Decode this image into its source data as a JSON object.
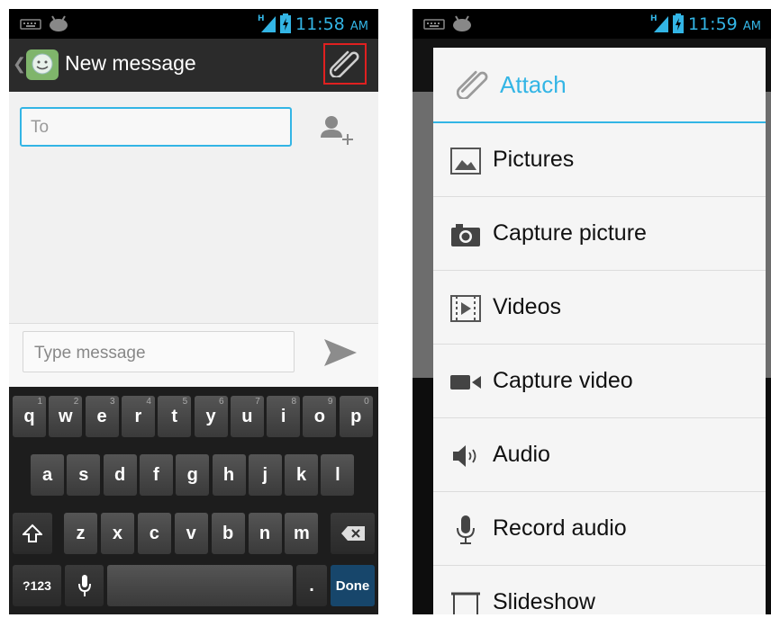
{
  "left": {
    "status": {
      "time": "11:58",
      "ampm": "AM"
    },
    "actionbar": {
      "title": "New message"
    },
    "compose": {
      "to_placeholder": "To",
      "message_placeholder": "Type message"
    },
    "keyboard": {
      "row1": [
        {
          "label": "q",
          "hint": "1"
        },
        {
          "label": "w",
          "hint": "2"
        },
        {
          "label": "e",
          "hint": "3"
        },
        {
          "label": "r",
          "hint": "4"
        },
        {
          "label": "t",
          "hint": "5"
        },
        {
          "label": "y",
          "hint": "6"
        },
        {
          "label": "u",
          "hint": "7"
        },
        {
          "label": "i",
          "hint": "8"
        },
        {
          "label": "o",
          "hint": "9"
        },
        {
          "label": "p",
          "hint": "0"
        }
      ],
      "row2": [
        "a",
        "s",
        "d",
        "f",
        "g",
        "h",
        "j",
        "k",
        "l"
      ],
      "row3": [
        "z",
        "x",
        "c",
        "v",
        "b",
        "n",
        "m"
      ],
      "symbols_label": "?123",
      "period_label": ".",
      "done_label": "Done"
    }
  },
  "right": {
    "status": {
      "time": "11:59",
      "ampm": "AM"
    },
    "dialog": {
      "title": "Attach",
      "items": [
        {
          "label": "Pictures",
          "icon": "picture-icon"
        },
        {
          "label": "Capture picture",
          "icon": "camera-icon"
        },
        {
          "label": "Videos",
          "icon": "video-file-icon"
        },
        {
          "label": "Capture video",
          "icon": "video-camera-icon"
        },
        {
          "label": "Audio",
          "icon": "speaker-icon"
        },
        {
          "label": "Record audio",
          "icon": "microphone-icon"
        },
        {
          "label": "Slideshow",
          "icon": "slideshow-icon"
        }
      ]
    }
  },
  "colors": {
    "accent": "#33b5e5",
    "highlight_border": "#e02020",
    "done_key": "#17466b"
  }
}
